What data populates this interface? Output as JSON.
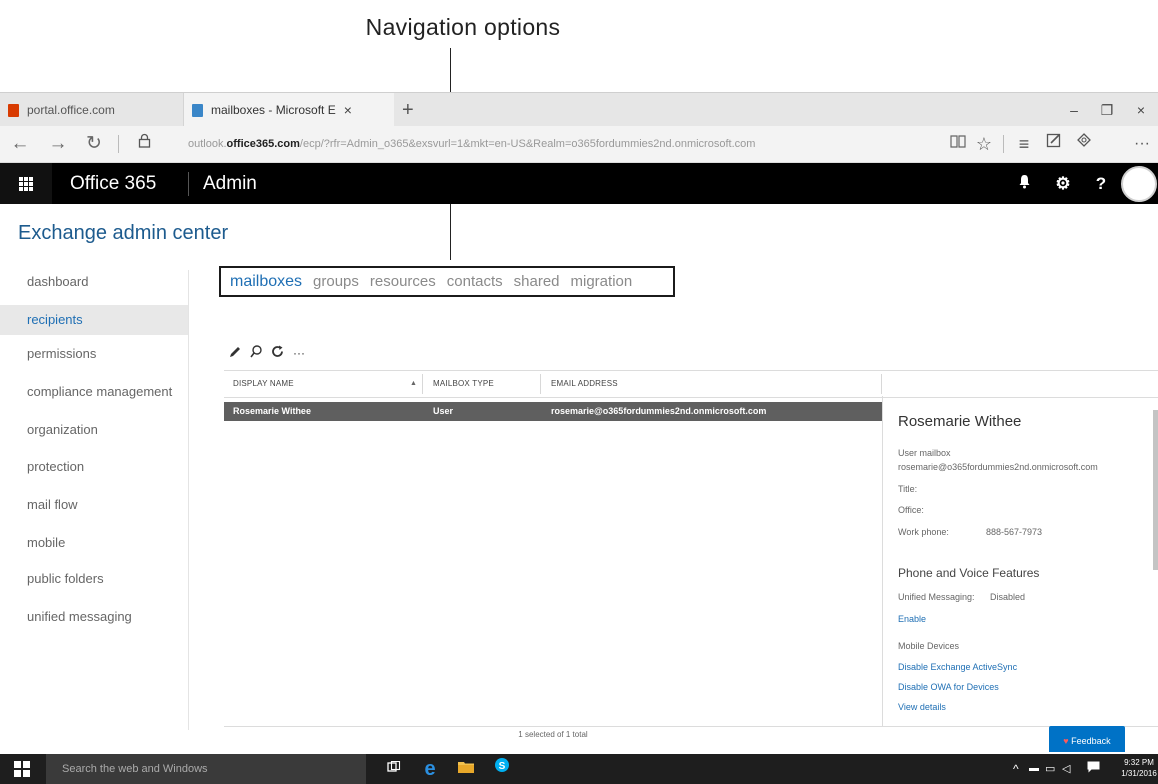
{
  "callout": {
    "label": "Navigation options"
  },
  "browser": {
    "tabs": [
      {
        "title": "portal.office.com",
        "fav_color": "#d83b01"
      },
      {
        "title": "mailboxes - Microsoft E",
        "fav_color": "#3a86c8"
      }
    ],
    "close_tab": "×",
    "new_tab": "+",
    "window_controls": {
      "minimize": "–",
      "restore": "❐",
      "close": "×"
    },
    "nav": {
      "back": "←",
      "forward": "→",
      "refresh": "↻",
      "lock": "🔒"
    },
    "url_prefix": "outlook.",
    "url_domain": "office365.com",
    "url_suffix": "/ecp/?rfr=Admin_o365&exsvurl=1&mkt=en-US&Realm=o365fordummies2nd.onmicrosoft.com",
    "toolbar_icons": [
      "reading-view-icon",
      "favorite-star-icon",
      "hub-icon",
      "web-note-icon",
      "share-icon",
      "more-icon"
    ]
  },
  "suite": {
    "brand": "Office 365",
    "app": "Admin",
    "icons": {
      "bell": "🔔",
      "gear": "⚙",
      "help": "?"
    }
  },
  "eac": {
    "title": "Exchange admin center",
    "left_nav": [
      "dashboard",
      "recipients",
      "permissions",
      "compliance management",
      "organization",
      "protection",
      "mail flow",
      "mobile",
      "public folders",
      "unified messaging"
    ],
    "selected_nav": "recipients",
    "sub_tabs": [
      "mailboxes",
      "groups",
      "resources",
      "contacts",
      "shared",
      "migration"
    ],
    "selected_sub_tab": "mailboxes",
    "toolbar": {
      "edit": "✎",
      "search": "⌕",
      "refresh": "↻",
      "more": "···"
    },
    "columns": [
      "DISPLAY NAME",
      "MAILBOX TYPE",
      "EMAIL ADDRESS"
    ],
    "sort_indicator": "▲",
    "rows": [
      {
        "display_name": "Rosemarie Withee",
        "mailbox_type": "User",
        "email": "rosemarie@o365fordummies2nd.onmicrosoft.com"
      }
    ],
    "details": {
      "name": "Rosemarie Withee",
      "mailbox_kind": "User mailbox",
      "email": "rosemarie@o365fordummies2nd.onmicrosoft.com",
      "title_label": "Title:",
      "office_label": "Office:",
      "work_phone_label": "Work phone:",
      "work_phone": "888-567-7973",
      "phone_voice_heading": "Phone and Voice Features",
      "um_label": "Unified Messaging:",
      "um_value": "Disabled",
      "enable_link": "Enable",
      "mobile_heading": "Mobile Devices",
      "disable_eas_link": "Disable Exchange ActiveSync",
      "disable_owa_link": "Disable OWA for Devices",
      "view_details_link": "View details"
    },
    "status": "1 selected of 1 total",
    "feedback": "Feedback"
  },
  "taskbar": {
    "search_placeholder": "Search the web and Windows",
    "time": "9:32 PM",
    "date": "1/31/2016"
  }
}
